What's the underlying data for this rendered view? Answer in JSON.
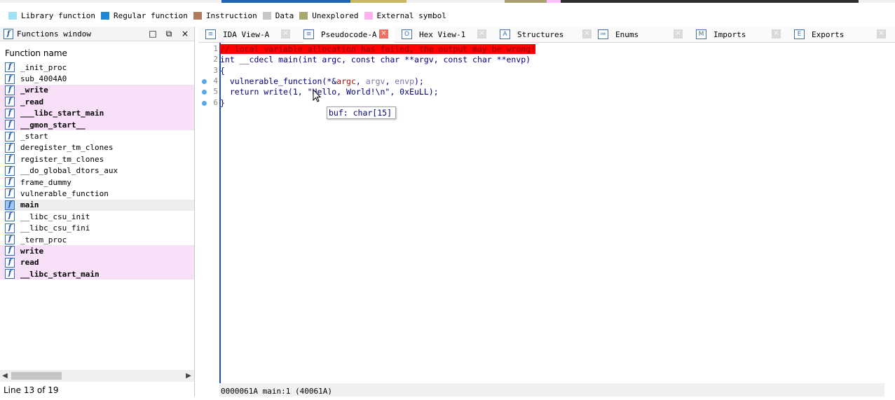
{
  "nav_band": {
    "colors": [
      "#1e64b0",
      "#f0c040",
      "#2d2d2d",
      "#a8a070",
      "#ffc0ff"
    ]
  },
  "legend": [
    {
      "label": "Library function",
      "color": "#9fe0f5"
    },
    {
      "label": "Regular function",
      "color": "#1e88d8"
    },
    {
      "label": "Instruction",
      "color": "#b07a5e"
    },
    {
      "label": "Data",
      "color": "#c8c8c8"
    },
    {
      "label": "Unexplored",
      "color": "#a8a870"
    },
    {
      "label": "External symbol",
      "color": "#ffb0f0"
    }
  ],
  "functions_window": {
    "title": "Functions window",
    "column_header": "Function name",
    "icon_glyph": "f",
    "buttons": {
      "restore": "□",
      "float": "⧉",
      "close": "×"
    },
    "items": [
      {
        "name": "_init_proc",
        "style": "normal"
      },
      {
        "name": "sub_4004A0",
        "style": "normal"
      },
      {
        "name": "_write",
        "style": "ext"
      },
      {
        "name": "_read",
        "style": "ext"
      },
      {
        "name": "___libc_start_main",
        "style": "ext"
      },
      {
        "name": "__gmon_start__",
        "style": "ext"
      },
      {
        "name": "_start",
        "style": "normal"
      },
      {
        "name": "deregister_tm_clones",
        "style": "normal"
      },
      {
        "name": "register_tm_clones",
        "style": "normal"
      },
      {
        "name": "__do_global_dtors_aux",
        "style": "normal"
      },
      {
        "name": "frame_dummy",
        "style": "normal"
      },
      {
        "name": "vulnerable_function",
        "style": "normal"
      },
      {
        "name": "main",
        "style": "selected"
      },
      {
        "name": "__libc_csu_init",
        "style": "normal"
      },
      {
        "name": "__libc_csu_fini",
        "style": "normal"
      },
      {
        "name": "_term_proc",
        "style": "normal"
      },
      {
        "name": "write",
        "style": "ext"
      },
      {
        "name": "read",
        "style": "ext"
      },
      {
        "name": "__libc_start_main",
        "style": "ext"
      }
    ],
    "status": "Line 13 of 19"
  },
  "tabs": [
    {
      "label": "IDA View-A",
      "icon": "≡",
      "active": false
    },
    {
      "label": "Pseudocode-A",
      "icon": "≡",
      "active": true
    },
    {
      "label": "Hex View-1",
      "icon": "O",
      "active": false
    },
    {
      "label": "Structures",
      "icon": "A",
      "active": false
    },
    {
      "label": "Enums",
      "icon": "≔",
      "active": false
    },
    {
      "label": "Imports",
      "icon": "M",
      "active": false
    },
    {
      "label": "Exports",
      "icon": "E",
      "active": false
    }
  ],
  "tab_close_glyph": "×",
  "pseudocode": {
    "lines": [
      {
        "num": "1",
        "bp": false
      },
      {
        "num": "2",
        "bp": false
      },
      {
        "num": "3",
        "bp": false
      },
      {
        "num": "4",
        "bp": true
      },
      {
        "num": "5",
        "bp": true
      },
      {
        "num": "6",
        "bp": true
      }
    ],
    "line1": "// local variable allocation has failed, the output may be wrong!",
    "line2": "int __cdecl main(int argc, const char **argv, const char **envp)",
    "line3": "{",
    "line4_a": "  vulnerable_function(*&",
    "line4_b": "argc",
    "line4_c": ", ",
    "line4_d": "argv",
    "line4_e": ", ",
    "line4_f": "envp",
    "line4_g": ");",
    "line5": "  return write(1, \"Hello, World!\\n\", 0xEuLL);",
    "line6": "}"
  },
  "tooltip": "buf: char[15]",
  "status_bar": "0000061A main:1 (40061A)"
}
